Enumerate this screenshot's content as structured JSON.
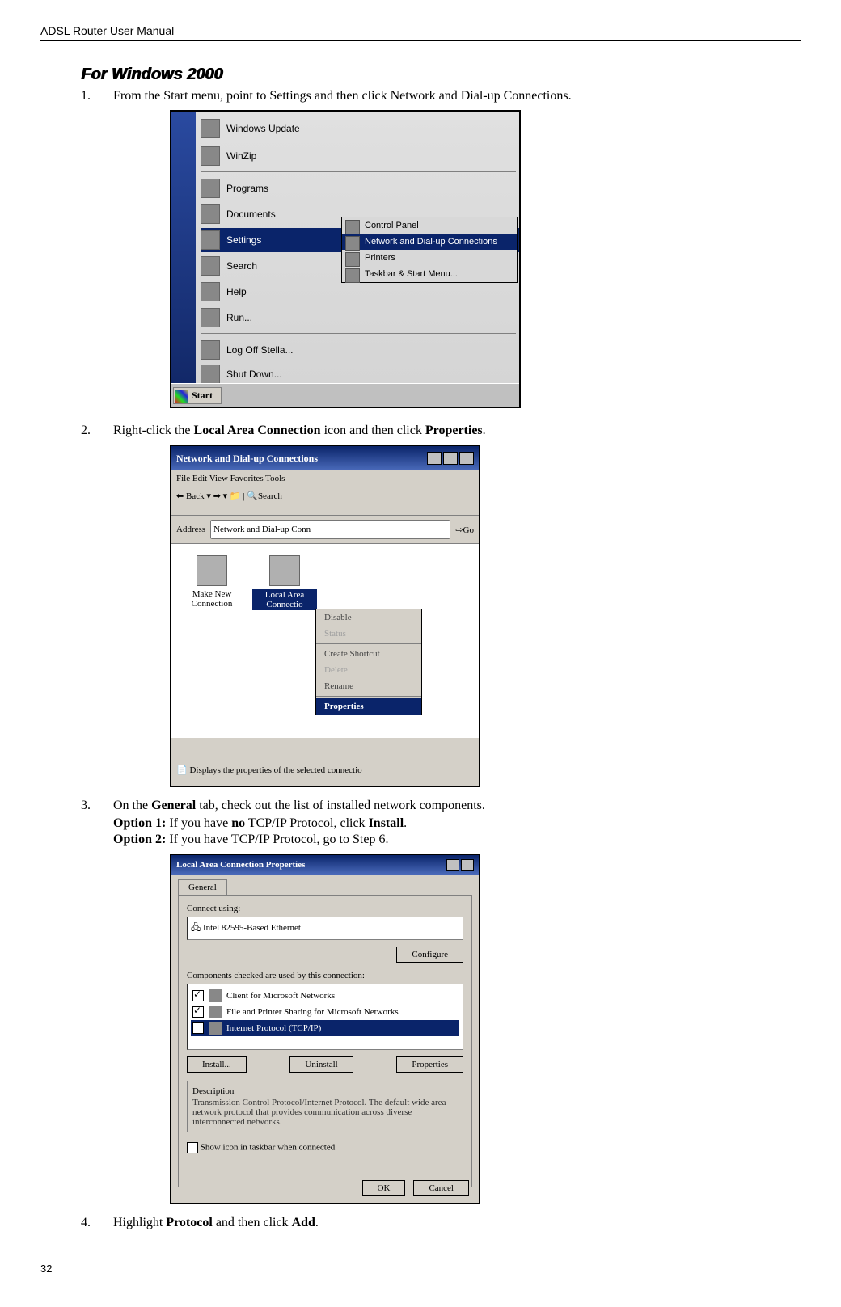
{
  "header": "ADSL Router User Manual",
  "section_title": "For Windows 2000",
  "steps": {
    "s1_num": "1.",
    "s1_text_a": "From the Start menu, point to Settings and then click Network and Dial-up Connections.",
    "s2_num": "2.",
    "s2_text_a": "Right-click the ",
    "s2_bold1": "Local Area Connection",
    "s2_text_b": " icon and then click ",
    "s2_bold2": "Properties",
    "s2_text_c": ".",
    "s3_num": "3.",
    "s3_text_a": "On the ",
    "s3_bold1": "General",
    "s3_text_b": " tab, check out the list of installed network components.",
    "opt1_a": "Option 1:",
    "opt1_b": " If you have ",
    "opt1_c": "no",
    "opt1_d": " TCP/IP Protocol, click ",
    "opt1_e": "Install",
    "opt1_f": ".",
    "opt2_a": "Option 2:",
    "opt2_b": " If you have TCP/IP Protocol, go to Step 6.",
    "s4_num": "4.",
    "s4_text_a": "Highlight ",
    "s4_bold1": "Protocol",
    "s4_text_b": " and then click ",
    "s4_bold2": "Add",
    "s4_text_c": "."
  },
  "fig1": {
    "items": {
      "wu": "Windows Update",
      "wz": "WinZip",
      "pg": "Programs",
      "dc": "Documents",
      "st": "Settings",
      "sr": "Search",
      "hp": "Help",
      "rn": "Run...",
      "lo": "Log Off Stella...",
      "sd": "Shut Down..."
    },
    "submenu": {
      "cp": "Control Panel",
      "nd": "Network and Dial-up Connections",
      "pr": "Printers",
      "tb": "Taskbar & Start Menu..."
    },
    "start": "Start"
  },
  "fig2": {
    "title": "Network and Dial-up Connections",
    "menu": "File   Edit   View   Favorites   Tools",
    "toolbar_back": "Back",
    "toolbar_search": "Search",
    "addr_label": "Address",
    "addr_val": "Network and Dial-up Conn",
    "go": "Go",
    "icon1": "Make New Connection",
    "icon2a": "Local Area",
    "icon2b": "Connectio",
    "ctx": {
      "disable": "Disable",
      "status": "Status",
      "shortcut": "Create Shortcut",
      "delete": "Delete",
      "rename": "Rename",
      "props": "Properties"
    },
    "status": "Displays the properties of the selected connectio"
  },
  "fig3": {
    "title": "Local Area Connection Properties",
    "tab": "General",
    "connect_using": "Connect using:",
    "adapter": "Intel 82595-Based Ethernet",
    "configure": "Configure",
    "comps_label": "Components checked are used by this connection:",
    "c1": "Client for Microsoft Networks",
    "c2": "File and Printer Sharing for Microsoft Networks",
    "c3": "Internet Protocol (TCP/IP)",
    "install": "Install...",
    "uninstall": "Uninstall",
    "properties": "Properties",
    "desc_h": "Description",
    "desc": "Transmission Control Protocol/Internet Protocol. The default wide area network protocol that provides communication across diverse interconnected networks.",
    "show_icon": "Show icon in taskbar when connected",
    "ok": "OK",
    "cancel": "Cancel"
  },
  "page_number": "32"
}
